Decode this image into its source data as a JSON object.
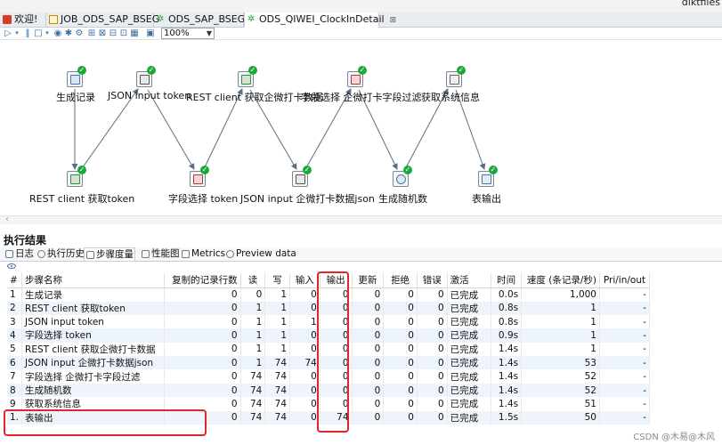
{
  "window": {
    "title_fragment": "diktfiles"
  },
  "tabs": [
    {
      "label": "欢迎!",
      "icon": "welcome-icon"
    },
    {
      "label": "JOB_ODS_SAP_BSEG",
      "icon": "job-icon"
    },
    {
      "label": "ODS_SAP_BSEG",
      "icon": "transformation-icon"
    },
    {
      "label": "ODS_QIWEI_ClockInDetail",
      "icon": "transformation-icon",
      "close": "⊠"
    }
  ],
  "toolbar": {
    "zoom": "100%"
  },
  "canvas": {
    "steps": [
      {
        "label": "生成记录",
        "icon": "generate-rows-icon"
      },
      {
        "label": "REST client 获取token",
        "icon": "rest-client-icon"
      },
      {
        "label": "JSON input token",
        "icon": "json-input-icon"
      },
      {
        "label": "字段选择 token",
        "icon": "select-values-icon"
      },
      {
        "label": "REST client 获取企微打卡数据",
        "icon": "rest-client-icon"
      },
      {
        "label": "JSON input 企微打卡数据json",
        "icon": "json-input-icon"
      },
      {
        "label": "字段选择 企微打卡字段过滤",
        "icon": "select-values-icon"
      },
      {
        "label": "生成随机数",
        "icon": "random-value-icon"
      },
      {
        "label": "获取系统信息",
        "icon": "system-info-icon"
      },
      {
        "label": "表输出",
        "icon": "table-output-icon"
      }
    ]
  },
  "results": {
    "title": "执行结果",
    "tabs": [
      "日志",
      "执行历史",
      "步骤度量",
      "性能图",
      "Metrics",
      "Preview data"
    ],
    "active_tab": "步骤度量",
    "columns": [
      "#",
      "步骤名称",
      "复制的记录行数",
      "读",
      "写",
      "输入",
      "输出",
      "更新",
      "拒绝",
      "错误",
      "激活",
      "时间",
      "速度 (条记录/秒)",
      "Pri/in/out"
    ],
    "rows": [
      [
        "1",
        "生成记录",
        "0",
        "0",
        "1",
        "0",
        "0",
        "0",
        "0",
        "0",
        "已完成",
        "0.0s",
        "1,000",
        "-"
      ],
      [
        "2",
        "REST client 获取token",
        "0",
        "1",
        "1",
        "0",
        "0",
        "0",
        "0",
        "0",
        "已完成",
        "0.8s",
        "1",
        "-"
      ],
      [
        "3",
        "JSON input token",
        "0",
        "1",
        "1",
        "1",
        "0",
        "0",
        "0",
        "0",
        "已完成",
        "0.8s",
        "1",
        "-"
      ],
      [
        "4",
        "字段选择 token",
        "0",
        "1",
        "1",
        "0",
        "0",
        "0",
        "0",
        "0",
        "已完成",
        "0.9s",
        "1",
        "-"
      ],
      [
        "5",
        "REST client 获取企微打卡数据",
        "0",
        "1",
        "1",
        "0",
        "0",
        "0",
        "0",
        "0",
        "已完成",
        "1.4s",
        "1",
        "-"
      ],
      [
        "6",
        "JSON input 企微打卡数据json",
        "0",
        "1",
        "74",
        "74",
        "0",
        "0",
        "0",
        "0",
        "已完成",
        "1.4s",
        "53",
        "-"
      ],
      [
        "7",
        "字段选择 企微打卡字段过滤",
        "0",
        "74",
        "74",
        "0",
        "0",
        "0",
        "0",
        "0",
        "已完成",
        "1.4s",
        "52",
        "-"
      ],
      [
        "8",
        "生成随机数",
        "0",
        "74",
        "74",
        "0",
        "0",
        "0",
        "0",
        "0",
        "已完成",
        "1.4s",
        "52",
        "-"
      ],
      [
        "9",
        "获取系统信息",
        "0",
        "74",
        "74",
        "0",
        "0",
        "0",
        "0",
        "0",
        "已完成",
        "1.4s",
        "51",
        "-"
      ],
      [
        "1.",
        "表输出",
        "0",
        "74",
        "74",
        "0",
        "74",
        "0",
        "0",
        "0",
        "已完成",
        "1.5s",
        "50",
        "-"
      ]
    ]
  },
  "watermark": "CSDN @木易@木风",
  "colors": {
    "highlight": "#e0262b",
    "ok": "#1fa83a",
    "row_alt": "#eef4fb"
  }
}
